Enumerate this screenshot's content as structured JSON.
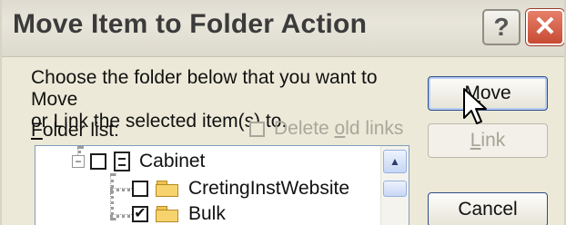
{
  "window": {
    "title": "Move Item to Folder Action",
    "help_icon": "?",
    "close_icon": "✕"
  },
  "instructions": {
    "line1": "Choose the folder below that you want to Move",
    "line2": "or Link the selected item(s) to."
  },
  "folder_list": {
    "label_prefix": "F",
    "label_rest": "older list:"
  },
  "delete_old_links": {
    "label_pre": "Delete ",
    "label_ul": "o",
    "label_post": "ld links",
    "checked": false,
    "enabled": false
  },
  "buttons": {
    "move_ul": "M",
    "move_rest": "ove",
    "link_ul": "L",
    "link_rest": "ink",
    "cancel": "Cancel"
  },
  "tree": {
    "items": [
      {
        "label": "Cabinet",
        "checked": false,
        "expanded": true,
        "icon": "cabinet-icon"
      },
      {
        "label": "CretingInstWebsite",
        "checked": false,
        "icon": "folder-icon"
      },
      {
        "label": "Bulk",
        "checked": true,
        "icon": "folder-icon"
      }
    ],
    "expander": "−",
    "check_mark": "✔",
    "scroll_up": "▲"
  },
  "colors": {
    "dialog_bg": "#ece9d8",
    "close_button": "#c74b33",
    "button_border": "#2d4c86"
  }
}
